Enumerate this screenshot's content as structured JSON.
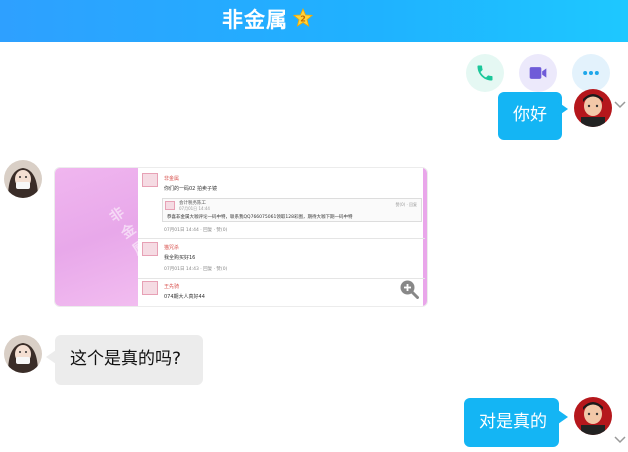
{
  "header": {
    "title": "非金属",
    "vip_level": "2",
    "colors": {
      "start": "#2ea0ff",
      "end": "#1ec8ff"
    }
  },
  "actions": [
    {
      "name": "phone-icon",
      "color": "#1cc79a"
    },
    {
      "name": "video-camera-icon",
      "color": "#6f5bd8"
    },
    {
      "name": "more-dots-icon",
      "color": "#1ea7ea"
    }
  ],
  "messages": [
    {
      "from": "self",
      "type": "text",
      "text": "你好"
    },
    {
      "from": "other",
      "type": "image",
      "image": {
        "watermark": "非金属",
        "posts": [
          {
            "name": "非金属",
            "text": "你们的一码02 拍卖子镜",
            "meta": "07月01日 14:44 · 回复 · 赞(0)",
            "quote": {
              "name": "会计税务陈工",
              "time": "07月01日 14:44",
              "text": "恭喜非金属大咖评论一码中特，联系我QQ766075061领取128彩图，期待大咖下期一码中特",
              "meta": "赞(0) · 回复"
            }
          },
          {
            "name": "猫咒杀",
            "text": "我全购买好16",
            "meta": "07月01日 14:43 · 回复 · 赞(0)"
          },
          {
            "name": "王先骑",
            "text": "074期大人真好44",
            "meta": ""
          }
        ]
      }
    },
    {
      "from": "other",
      "type": "text",
      "text": "这个是真的吗?"
    },
    {
      "from": "self",
      "type": "text",
      "text": "对是真的"
    }
  ],
  "colors": {
    "self_bubble": "#14b5f4",
    "other_bubble": "#ececec"
  }
}
